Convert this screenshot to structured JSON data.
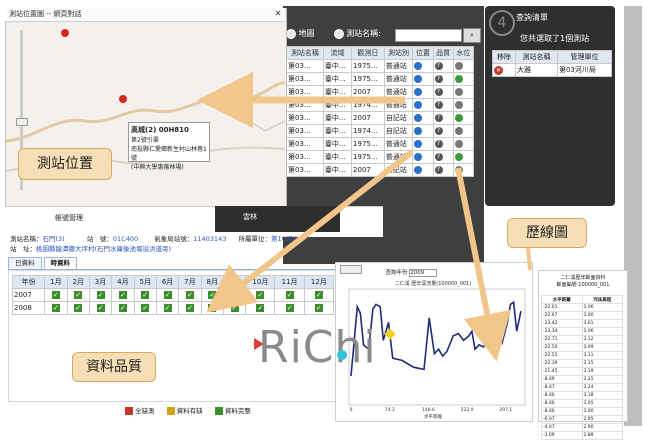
{
  "map_window": {
    "title": "測站位置圖 -- 網頁對話",
    "close": "✕",
    "popup_title": "高城(2) 00H810",
    "popup_line1": "第2號引渠",
    "popup_line2": "南投縣仁愛鄉新生村山林巷1號",
    "popup_line3": "(中興大學惠蓀林場)"
  },
  "search_bar": {
    "radio_map": "地圖",
    "radio_name": "測站名稱:"
  },
  "station_table": {
    "headers": [
      "測站編號",
      "測站名稱",
      "流域",
      "觀測日",
      "測站別",
      "位置",
      "品質",
      "水位"
    ],
    "rows": [
      [
        "",
        "第03...",
        "臺中...",
        "1975...",
        "普通站"
      ],
      [
        "",
        "第03...",
        "臺中...",
        "1975...",
        "普通站"
      ],
      [
        "",
        "第03...",
        "臺中...",
        "2007",
        "普通站"
      ],
      [
        "",
        "第03...",
        "臺中...",
        "1974...",
        "普通站"
      ],
      [
        "",
        "第03...",
        "臺中...",
        "2007",
        "自記站"
      ],
      [
        "",
        "第03...",
        "臺中...",
        "1974...",
        "自記站"
      ],
      [
        "",
        "第03...",
        "臺中...",
        "1975...",
        "普通站"
      ],
      [
        "",
        "第03...",
        "臺中...",
        "1975...",
        "普通站"
      ],
      [
        "",
        "第03...",
        "臺中...",
        "2007",
        "自記站"
      ]
    ]
  },
  "right_panel": {
    "step": "4",
    "title": "查詢清單",
    "count_text": "您共選取了1個測站",
    "headers": [
      "移除",
      "測站名稱",
      "管理單位"
    ],
    "rows": [
      [
        "大雅",
        "第03河川局"
      ]
    ]
  },
  "callouts": {
    "location": "測站位置",
    "history": "歷線圖",
    "quality": "資料品質"
  },
  "middle": {
    "tree_label": "帳號管理",
    "dark_label": "雲林",
    "info_line1_a": "測站名稱：",
    "info_line1_b": "石門(3)",
    "info_line1_c": "站　號：",
    "info_line1_d": "01C400",
    "info_line1_e": "氣象局站號：",
    "info_line1_f": "11403143",
    "info_line1_g": "所屬單位：",
    "info_line1_h": "第10河川局",
    "info_line2_a": "站　址：",
    "info_line2_b": "桃園縣龍潭鄉大坪村(石門水庫後池堰溢洪道旁)"
  },
  "tabs": [
    "日資料",
    "時資料"
  ],
  "quality_table": {
    "headers": [
      "年份",
      "1月",
      "2月",
      "3月",
      "4月",
      "5月",
      "6月",
      "7月",
      "8月",
      "9月",
      "10月",
      "11月",
      "12月"
    ],
    "rows": [
      {
        "year": "2007"
      },
      {
        "year": "2008"
      }
    ]
  },
  "legend": {
    "missing": "全缺測",
    "partial": "資料有缺",
    "complete": "資料完整"
  },
  "chart_window": {
    "year_label": "查詢年份",
    "year_value": "2009",
    "title": "二仁溪 歷年逕流量(100000_001)",
    "x_ticks": [
      "0",
      "74.3",
      "148.6",
      "222.9",
      "297.1"
    ],
    "x_label": "水平距離"
  },
  "hist_window": {
    "title": "二仁溪歷年斷面資料",
    "subtitle": "斷面編號:100000_001",
    "headers": [
      "水平距離",
      "河床高程"
    ],
    "rows": [
      [
        "-22.01",
        "3.06"
      ],
      [
        "-22.67",
        "3.00"
      ],
      [
        "-23.42",
        "3.01"
      ],
      [
        "-23.34",
        "3.06"
      ],
      [
        "-22.71",
        "3.12"
      ],
      [
        "-22.50",
        "3.09"
      ],
      [
        "-22.55",
        "3.11"
      ],
      [
        "-22.39",
        "3.15"
      ],
      [
        "-21.45",
        "3.19"
      ],
      [
        "-8.09",
        "3.25"
      ],
      [
        "-8.07",
        "3.24"
      ],
      [
        "-8.00",
        "3.18"
      ],
      [
        "-8.00",
        "3.05"
      ],
      [
        "-8.00",
        "3.00"
      ],
      [
        "-6.07",
        "2.95"
      ],
      [
        "-4.07",
        "2.90"
      ],
      [
        "-3.09",
        "2.88"
      ]
    ]
  },
  "logo": {
    "text": "RiChi"
  },
  "chart_data": {
    "type": "line",
    "title": "二仁溪 歷年逕流量(100000_001)",
    "xlabel": "水平距離",
    "ylabel": "",
    "x": [
      0,
      12,
      18,
      24,
      34,
      42,
      48,
      56,
      62,
      72,
      80,
      98,
      120,
      140,
      150,
      160,
      168,
      176,
      184,
      196,
      206,
      216,
      226,
      232,
      238,
      246,
      254,
      262,
      270,
      280,
      290,
      300,
      306,
      312,
      318,
      326
    ],
    "series": [
      {
        "values": [
          0.2,
          3.3,
          3.0,
          1.6,
          1.4,
          3.2,
          3.4,
          3.3,
          1.8,
          2.6,
          1.0,
          0.9,
          0.6,
          0.5,
          2.8,
          1.2,
          1.4,
          1.1,
          1.3,
          2.0,
          2.1,
          1.8,
          2.0,
          2.2,
          1.4,
          1.6,
          1.5,
          1.8,
          1.9,
          2.4,
          1.7,
          2.6,
          3.4,
          3.5,
          2.2,
          3.1
        ]
      }
    ],
    "xlim": [
      0,
      330
    ],
    "ylim": [
      -1,
      4
    ],
    "x_ticks": [
      "0",
      "74.3",
      "148.6",
      "222.9",
      "297.1"
    ]
  }
}
